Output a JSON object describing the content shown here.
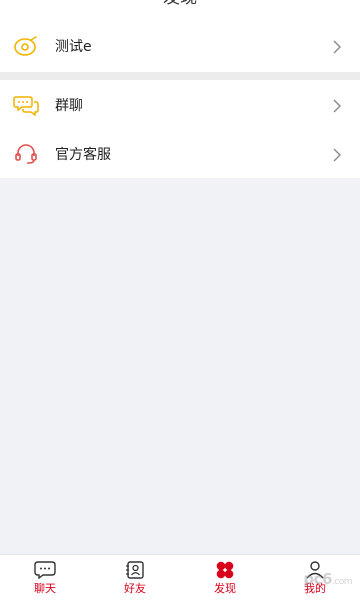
{
  "header": {
    "title": "发现"
  },
  "menu_groups": [
    {
      "items": [
        {
          "label": "测试e",
          "icon": "disc-icon",
          "icon_color": "#f0b400"
        }
      ]
    },
    {
      "items": [
        {
          "label": "群聊",
          "icon": "chat-bubbles-icon",
          "icon_color": "#f0b400"
        },
        {
          "label": "官方客服",
          "icon": "headset-icon",
          "icon_color": "#e0504b"
        }
      ]
    }
  ],
  "arrow_icon": "chevron-right-icon",
  "tabbar": {
    "accent_color": "#d9001b",
    "tabs": [
      {
        "label": "聊天",
        "icon": "chat-icon"
      },
      {
        "label": "好友",
        "icon": "contacts-icon"
      },
      {
        "label": "发现",
        "icon": "clover-icon",
        "active": true
      },
      {
        "label": "我的",
        "icon": "person-icon"
      }
    ]
  },
  "watermark": {
    "main": "pc6",
    "sub": ".com"
  }
}
